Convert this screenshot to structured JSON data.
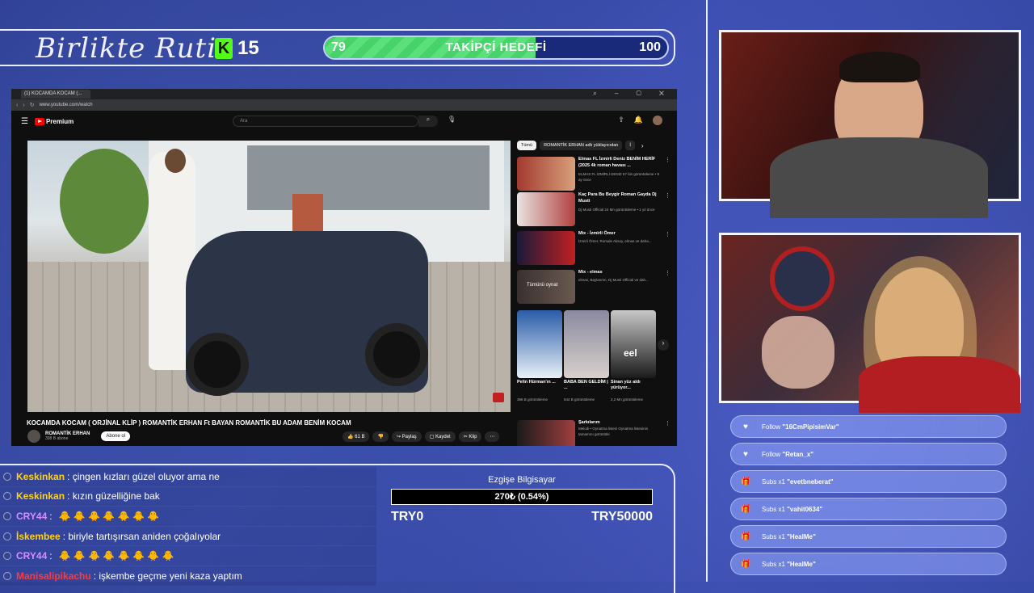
{
  "overlay": {
    "logo_text": "Birlikte Rutin",
    "kick_count": "15",
    "goal": {
      "current_label": "79",
      "title": "TAKİPÇİ HEDEFİ",
      "max_label": "100",
      "progress": 0.79
    }
  },
  "browser": {
    "tab_title": "(1) KOCAMDA KOCAM (...",
    "url": "www.youtube.com/watch",
    "search_placeholder": "Ara",
    "brand": "Premium",
    "video_title": "KOCAMDA KOCAM ( ORJİNAL KLİP ) ROMANTİK ERHAN Ft BAYAN ROMANTİK BU ADAM BENİM KOCAM",
    "channel": "ROMANTİK ERHAN",
    "subscribers": "398 B abone",
    "subscribe_label": "Abone ol",
    "actions": [
      "61 B",
      "",
      "Paylaş",
      "Kaydet",
      "Klip",
      "⋯"
    ],
    "chips": [
      "Tümü",
      "ROMANTİK ERHAN adlı yüklayıcıdan",
      "İ"
    ],
    "related": [
      {
        "title": "Elmas FL İzmirli Deniz BENİM HERİF (2025 4k roman havası ...",
        "meta": "ELMAS FL İZMİRLİ DENİZ\n57 bin görüntüleme • 9 ay önce",
        "duration": "3:15"
      },
      {
        "title": "Kaç Para Bu Beygir Roman Gayda Dj Musti",
        "meta": "Dj Musti Official\n24 Mn görüntüleme • 1 yıl önce",
        "duration": "2:35"
      },
      {
        "title": "Mix - İzmirli Ömer",
        "meta": "İzmirli Ömer, Romale Aksoy, elmas ve daha...",
        "duration": "Mix"
      },
      {
        "title": "Mix - elmas",
        "meta": "elmas, Baylanmn, Dj Musti Official ve dah...",
        "duration": "Mix",
        "overlay": "Tümünü oynat"
      }
    ],
    "shorts": [
      {
        "title": "Pelin Hürman'ın ...",
        "views": "396 B görüntüleme"
      },
      {
        "title": "BABA BEN GELDİM | ...",
        "views": "544 B görüntüleme"
      },
      {
        "title": "Sinan yüz aldı yürüyor...",
        "views": "2,2 Mn görüntüleme"
      }
    ],
    "short_overlay_text": "eel",
    "playlist": {
      "title": "Şarkılarım",
      "meta": "Melodi • Oynatma listesi\nOynatma listesinin tamamını görüntüle"
    }
  },
  "events": [
    {
      "icon": "heart",
      "type": "Follow",
      "user": "\"16CmPipisimVar\""
    },
    {
      "icon": "heart",
      "type": "Follow",
      "user": "\"Retan_x\""
    },
    {
      "icon": "gift",
      "type": "Subs x1",
      "user": "\"evetbneberat\""
    },
    {
      "icon": "gift",
      "type": "Subs x1",
      "user": "\"vahit0634\""
    },
    {
      "icon": "gift",
      "type": "Subs x1",
      "user": "\"HealMe\""
    },
    {
      "icon": "gift",
      "type": "Subs x1",
      "user": "\"HealMe\""
    }
  ],
  "chat": [
    {
      "user": "Keskinkan",
      "color": "#ffd21a",
      "msg": ": çingen kızları güzel oluyor ama ne"
    },
    {
      "user": "Keskinkan",
      "color": "#ffd21a",
      "msg": ": kızın güzelliğine bak"
    },
    {
      "user": "CRY44",
      "color": "#d98cff",
      "msg": ":",
      "emotes": "🐥 🐥 🐥 🐥 🐥 🐥 🐥"
    },
    {
      "user": "İskembee",
      "color": "#ffd21a",
      "msg": ": biriyle tartışırsan aniden çoğalıyolar"
    },
    {
      "user": "CRY44",
      "color": "#d98cff",
      "msg": ":",
      "emotes": "🐥 🐥 🐥 🐥 🐥 🐥 🐥 🐥"
    },
    {
      "user": "Manisalipikachu",
      "color": "#ff3b3b",
      "msg": ": işkembe geçme yeni kaza yaptım"
    }
  ],
  "donation": {
    "title": "Ezgişe Bilgisayar",
    "bar_text": "270₺ (0.54%)",
    "min": "TRY0",
    "max": "TRY50000"
  }
}
